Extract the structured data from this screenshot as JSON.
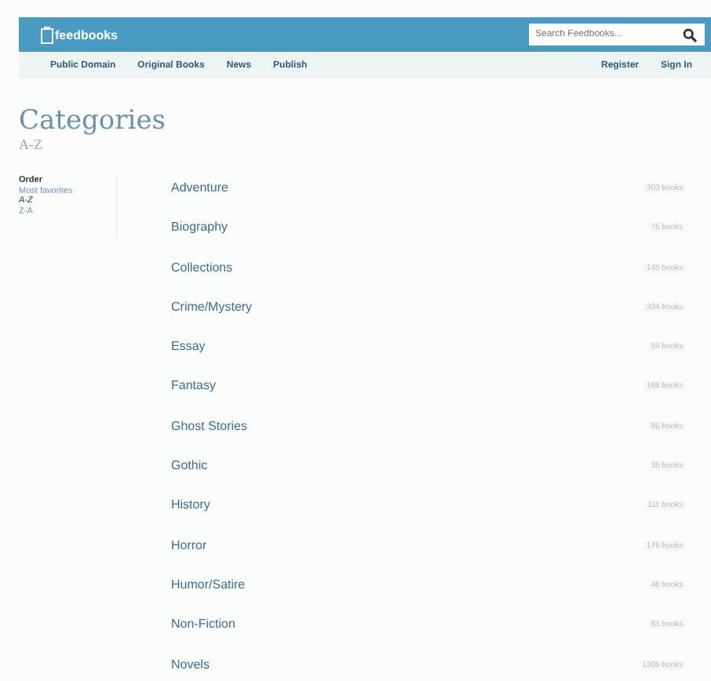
{
  "header": {
    "logo": "feedbooks",
    "search": {
      "placeholder": "Search Feedbooks..."
    }
  },
  "nav": {
    "left": [
      {
        "label": "Public Domain"
      },
      {
        "label": "Original Books"
      },
      {
        "label": "News"
      },
      {
        "label": "Publish"
      }
    ],
    "right": [
      {
        "label": "Register"
      },
      {
        "label": "Sign In"
      }
    ]
  },
  "title": "Categories",
  "subtitle": "A-Z",
  "sidebar": {
    "heading": "Order",
    "items": [
      {
        "label": "Most favorites",
        "selected": false
      },
      {
        "label": "A-Z",
        "selected": true
      },
      {
        "label": "Z-A",
        "selected": false
      }
    ]
  },
  "categories": [
    {
      "name": "Adventure",
      "count": "303 books"
    },
    {
      "name": "Biography",
      "count": "75 books"
    },
    {
      "name": "Collections",
      "count": "145 books"
    },
    {
      "name": "Crime/Mystery",
      "count": "334 books"
    },
    {
      "name": "Essay",
      "count": "59 books"
    },
    {
      "name": "Fantasy",
      "count": "168 books"
    },
    {
      "name": "Ghost Stories",
      "count": "85 books"
    },
    {
      "name": "Gothic",
      "count": "35 books"
    },
    {
      "name": "History",
      "count": "111 books"
    },
    {
      "name": "Horror",
      "count": "176 books"
    },
    {
      "name": "Humor/Satire",
      "count": "46 books"
    },
    {
      "name": "Non-Fiction",
      "count": "83 books"
    },
    {
      "name": "Novels",
      "count": "1305 books"
    }
  ]
}
